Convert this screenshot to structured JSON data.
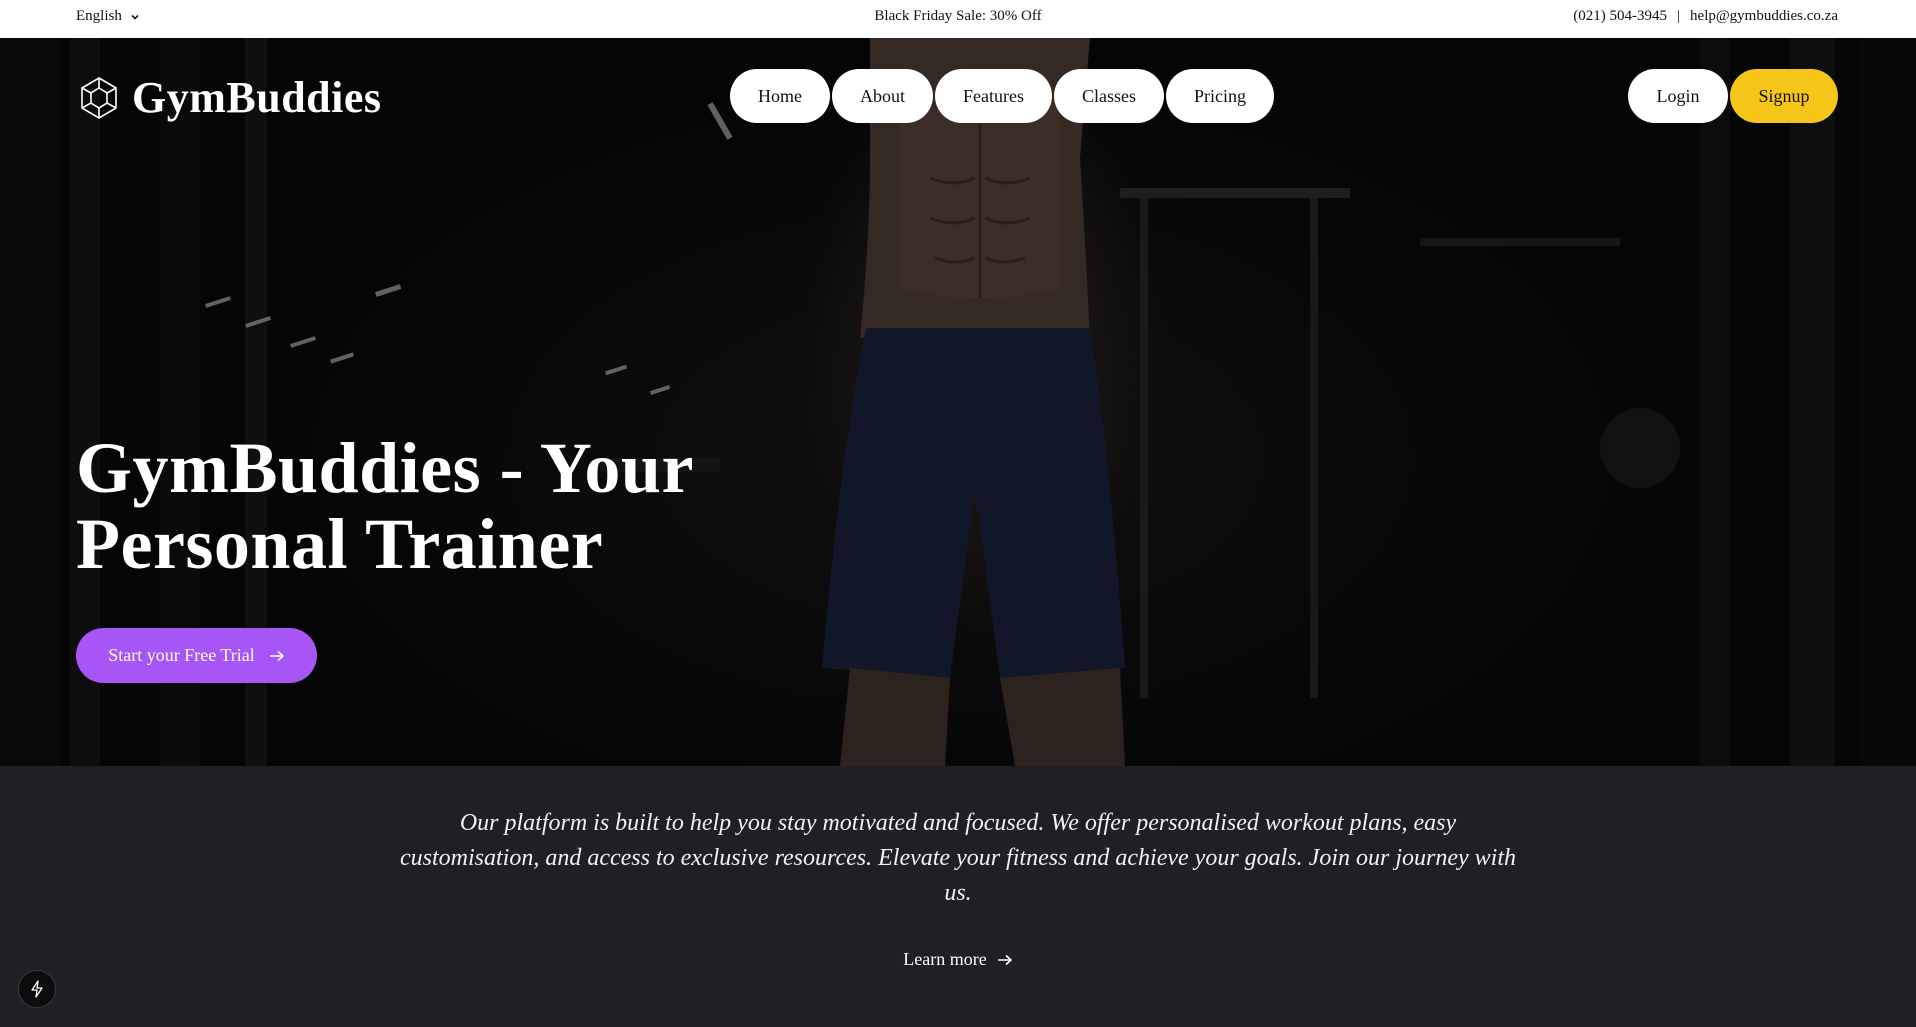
{
  "topbar": {
    "language": "English",
    "promo": "Black Friday Sale: 30% Off",
    "phone": "(021) 504-3945",
    "separator": "|",
    "email": "help@gymbuddies.co.za"
  },
  "header": {
    "brand": "GymBuddies",
    "nav": [
      "Home",
      "About",
      "Features",
      "Classes",
      "Pricing"
    ],
    "login": "Login",
    "signup": "Signup"
  },
  "hero": {
    "headline_line1": "GymBuddies - Your",
    "headline_line2": "Personal Trainer",
    "cta": "Start your Free Trial"
  },
  "intro": {
    "text": "Our platform is built to help you stay motivated and focused. We offer personalised workout plans, easy customisation, and access to exclusive resources. Elevate your fitness and achieve your goals. Join our journey with us.",
    "learn_more": "Learn more"
  },
  "icons": {
    "language_caret": "chevron-down-icon",
    "logo": "hexagon-cube-icon",
    "cta_arrow": "arrow-right-icon",
    "learn_arrow": "arrow-right-icon",
    "floating": "bolt-icon"
  },
  "colors": {
    "accent_purple": "#a755f7",
    "signup_yellow": "#f5c518",
    "section_bg": "#1e2025"
  }
}
